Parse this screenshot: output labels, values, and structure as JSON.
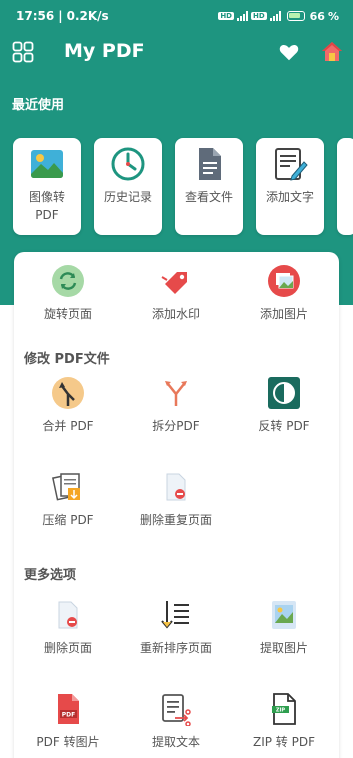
{
  "status_bar": {
    "time": "17:56",
    "speed": "0.2K/s",
    "battery": "66"
  },
  "app": {
    "title": "My PDF"
  },
  "recent": {
    "title": "最近使用",
    "items": [
      {
        "label": "图像转PDF",
        "icon": "image-icon"
      },
      {
        "label": "历史记录",
        "icon": "clock-icon"
      },
      {
        "label": "查看文件",
        "icon": "document-icon"
      },
      {
        "label": "添加文字",
        "icon": "edit-text-icon"
      }
    ]
  },
  "tools_top": [
    {
      "label": "旋转页面",
      "icon": "rotate-icon"
    },
    {
      "label": "添加水印",
      "icon": "tag-icon"
    },
    {
      "label": "添加图片",
      "icon": "add-image-icon"
    }
  ],
  "section_modify": {
    "title": "修改 PDF文件",
    "row1": [
      {
        "label": "合并 PDF",
        "icon": "merge-icon"
      },
      {
        "label": "拆分PDF",
        "icon": "split-icon"
      },
      {
        "label": "反转 PDF",
        "icon": "invert-icon"
      }
    ],
    "row2": [
      {
        "label": "压缩 PDF",
        "icon": "compress-icon"
      },
      {
        "label": "删除重复页面",
        "icon": "remove-duplicate-icon"
      }
    ]
  },
  "section_more": {
    "title": "更多选项",
    "row1": [
      {
        "label": "删除页面",
        "icon": "delete-page-icon"
      },
      {
        "label": "重新排序页面",
        "icon": "reorder-icon"
      },
      {
        "label": "提取图片",
        "icon": "extract-image-icon"
      }
    ],
    "row2": [
      {
        "label": "PDF 转图片",
        "icon": "pdf-to-image-icon"
      },
      {
        "label": "提取文本",
        "icon": "extract-text-icon"
      },
      {
        "label": "ZIP 转 PDF",
        "icon": "zip-icon"
      }
    ]
  },
  "colors": {
    "primary": "#1e9580",
    "accent_red": "#e64a4a",
    "background": "#ffffff"
  }
}
